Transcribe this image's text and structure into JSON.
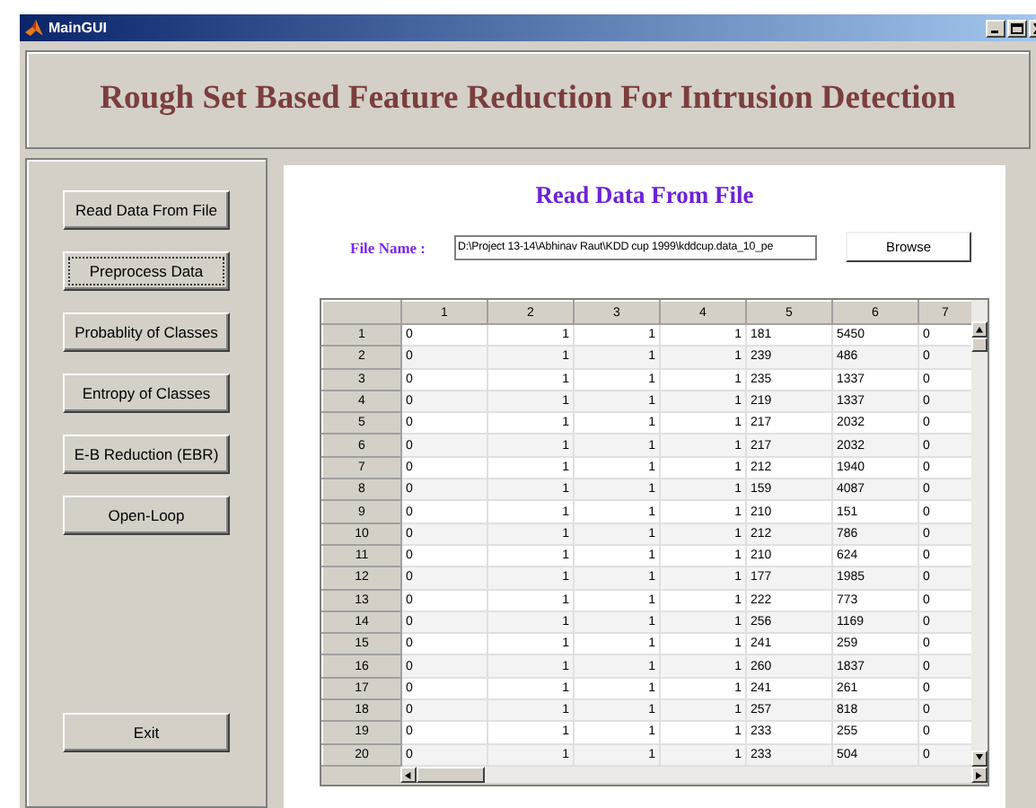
{
  "window": {
    "title": "MainGUI"
  },
  "header": {
    "title": "Rough Set Based Feature Reduction For Intrusion Detection"
  },
  "sidebar": {
    "buttons": [
      {
        "label": "Read Data From File",
        "focused": false
      },
      {
        "label": "Preprocess Data",
        "focused": true
      },
      {
        "label": "Probablity of Classes",
        "focused": false
      },
      {
        "label": "Entropy of Classes",
        "focused": false
      },
      {
        "label": "E-B Reduction (EBR)",
        "focused": false
      },
      {
        "label": "Open-Loop",
        "focused": false
      }
    ],
    "exit_button": "Exit"
  },
  "panel": {
    "title": "Read Data From File",
    "file_label": "File Name :",
    "file_path": "D:\\Project 13-14\\Abhinav Raut\\KDD cup 1999\\kddcup.data_10_pe",
    "browse_button": "Browse"
  },
  "table": {
    "columns": [
      "",
      "1",
      "2",
      "3",
      "4",
      "5",
      "6",
      "7"
    ],
    "rows": [
      [
        "1",
        "0",
        "1",
        "1",
        "1",
        "181",
        "5450",
        "0"
      ],
      [
        "2",
        "0",
        "1",
        "1",
        "1",
        "239",
        "486",
        "0"
      ],
      [
        "3",
        "0",
        "1",
        "1",
        "1",
        "235",
        "1337",
        "0"
      ],
      [
        "4",
        "0",
        "1",
        "1",
        "1",
        "219",
        "1337",
        "0"
      ],
      [
        "5",
        "0",
        "1",
        "1",
        "1",
        "217",
        "2032",
        "0"
      ],
      [
        "6",
        "0",
        "1",
        "1",
        "1",
        "217",
        "2032",
        "0"
      ],
      [
        "7",
        "0",
        "1",
        "1",
        "1",
        "212",
        "1940",
        "0"
      ],
      [
        "8",
        "0",
        "1",
        "1",
        "1",
        "159",
        "4087",
        "0"
      ],
      [
        "9",
        "0",
        "1",
        "1",
        "1",
        "210",
        "151",
        "0"
      ],
      [
        "10",
        "0",
        "1",
        "1",
        "1",
        "212",
        "786",
        "0"
      ],
      [
        "11",
        "0",
        "1",
        "1",
        "1",
        "210",
        "624",
        "0"
      ],
      [
        "12",
        "0",
        "1",
        "1",
        "1",
        "177",
        "1985",
        "0"
      ],
      [
        "13",
        "0",
        "1",
        "1",
        "1",
        "222",
        "773",
        "0"
      ],
      [
        "14",
        "0",
        "1",
        "1",
        "1",
        "256",
        "1169",
        "0"
      ],
      [
        "15",
        "0",
        "1",
        "1",
        "1",
        "241",
        "259",
        "0"
      ],
      [
        "16",
        "0",
        "1",
        "1",
        "1",
        "260",
        "1837",
        "0"
      ],
      [
        "17",
        "0",
        "1",
        "1",
        "1",
        "241",
        "261",
        "0"
      ],
      [
        "18",
        "0",
        "1",
        "1",
        "1",
        "257",
        "818",
        "0"
      ],
      [
        "19",
        "0",
        "1",
        "1",
        "1",
        "233",
        "255",
        "0"
      ],
      [
        "20",
        "0",
        "1",
        "1",
        "1",
        "233",
        "504",
        "0"
      ]
    ]
  }
}
